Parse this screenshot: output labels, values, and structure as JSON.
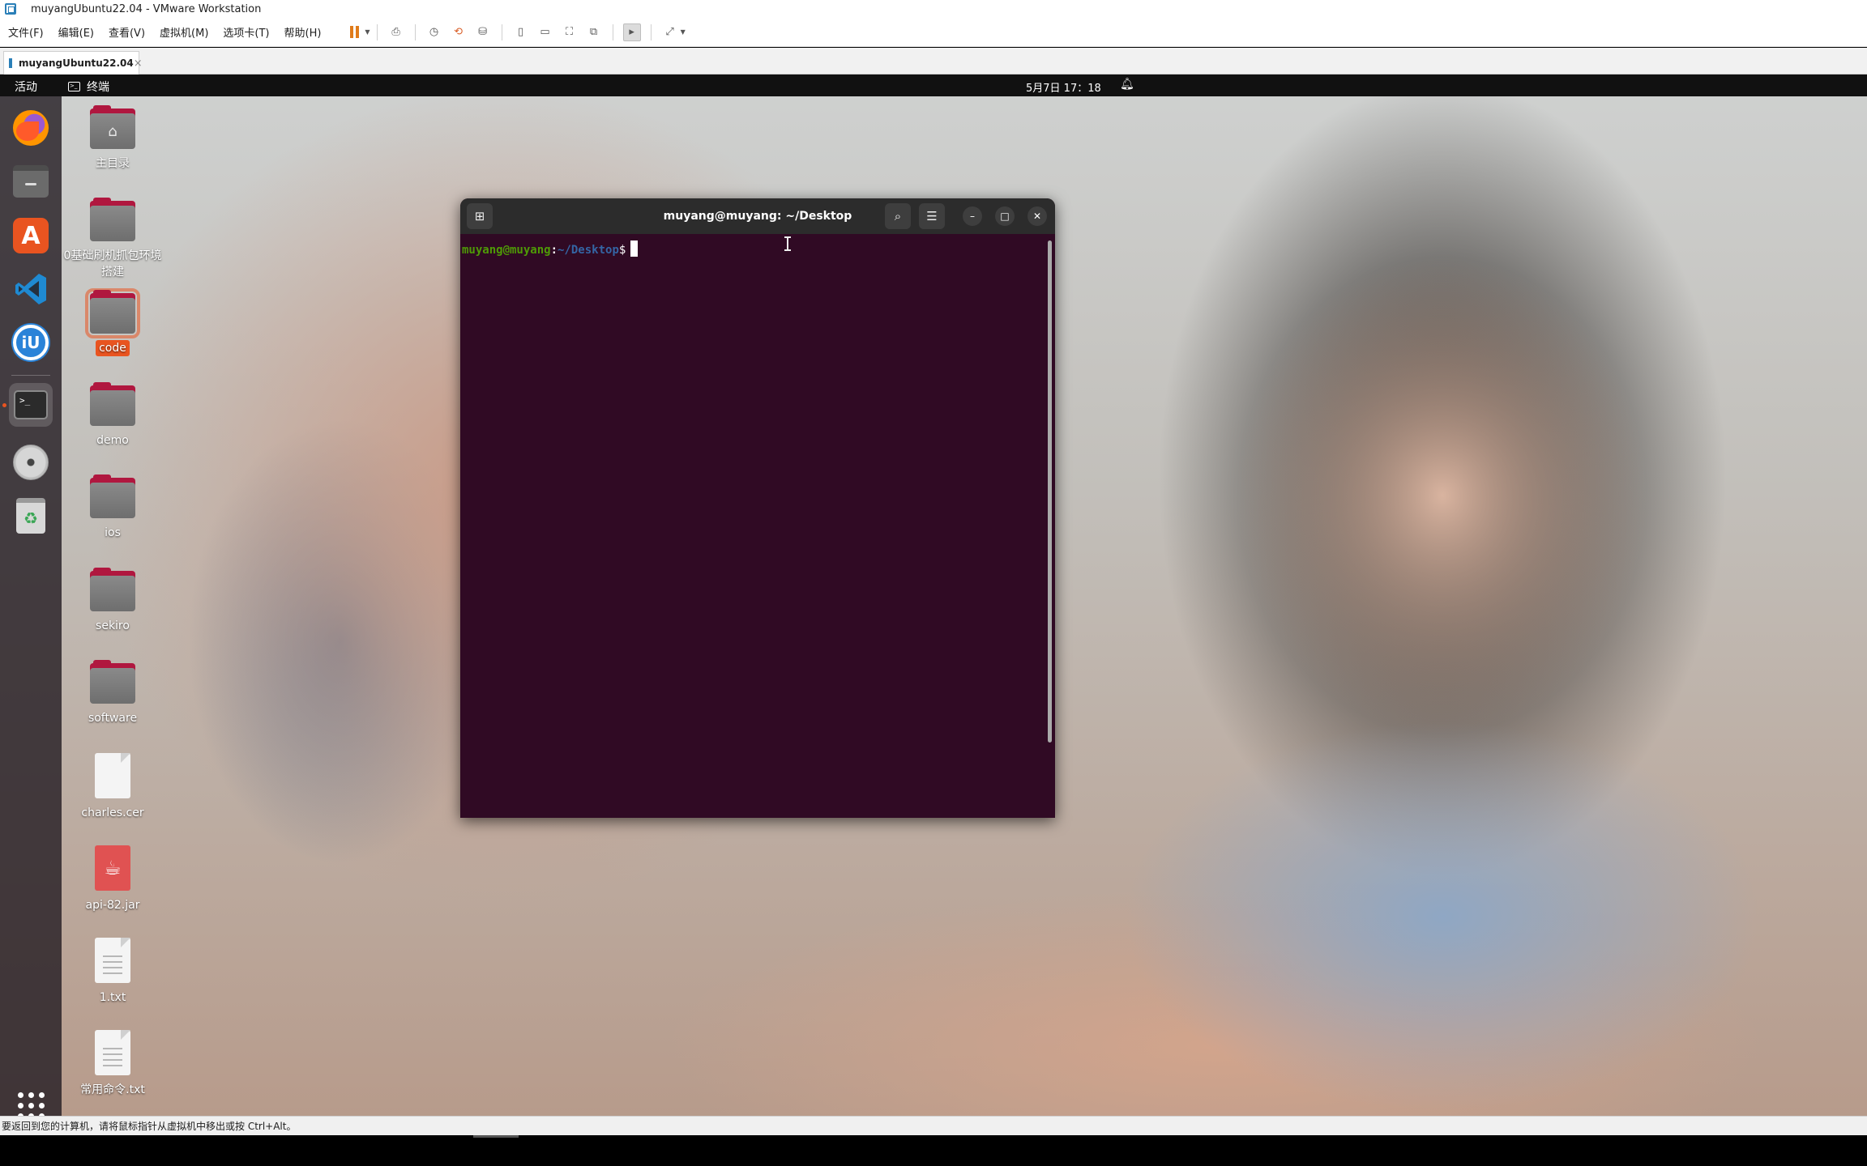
{
  "window": {
    "title": "muyangUbuntu22.04 - VMware Workstation"
  },
  "menu": [
    "文件(F)",
    "编辑(E)",
    "查看(V)",
    "虚拟机(M)",
    "选项卡(T)",
    "帮助(H)"
  ],
  "toolbar_icons": [
    "pause-icon",
    "send-ctrl-alt-del-icon",
    "snapshot-icon",
    "revert-snapshot-icon",
    "snapshot-manager-icon",
    "library-icon",
    "thumbnail-icon",
    "fullscreen-icon",
    "unity-icon",
    "console-icon",
    "stretch-icon"
  ],
  "tab": {
    "label": "muyangUbuntu22.04",
    "close": "×"
  },
  "topbar": {
    "activities": "活动",
    "app": "终端",
    "clock": "5月7日 17：18"
  },
  "dock": [
    "firefox",
    "files",
    "ubuntu-software",
    "vscode",
    "intellij-idea",
    "terminal",
    "dvd-drive",
    "trash",
    "show-applications"
  ],
  "desktop": {
    "icons": [
      {
        "label": "主目录",
        "kind": "home-folder"
      },
      {
        "label": "0基础刷机抓包环境搭建",
        "kind": "folder"
      },
      {
        "label": "code",
        "kind": "folder",
        "selected": true
      },
      {
        "label": "demo",
        "kind": "folder"
      },
      {
        "label": "ios",
        "kind": "folder"
      },
      {
        "label": "sekiro",
        "kind": "folder"
      },
      {
        "label": "software",
        "kind": "folder"
      },
      {
        "label": "charles.cer",
        "kind": "file"
      },
      {
        "label": "api-82.jar",
        "kind": "jar"
      },
      {
        "label": "1.txt",
        "kind": "text"
      },
      {
        "label": "常用命令.txt",
        "kind": "text"
      }
    ]
  },
  "terminal": {
    "title": "muyang@muyang: ~/Desktop",
    "prompt_user": "muyang@muyang",
    "prompt_colon": ":",
    "prompt_path": "~/Desktop",
    "prompt_dollar": "$"
  },
  "statusbar": {
    "text": "要返回到您的计算机，请将鼠标指针从虚拟机中移出或按 Ctrl+Alt。"
  },
  "colors": {
    "terminal_bg": "#300a24",
    "ubuntu_orange": "#e95420",
    "prompt_green": "#4e9a06",
    "prompt_blue": "#3465a4"
  }
}
